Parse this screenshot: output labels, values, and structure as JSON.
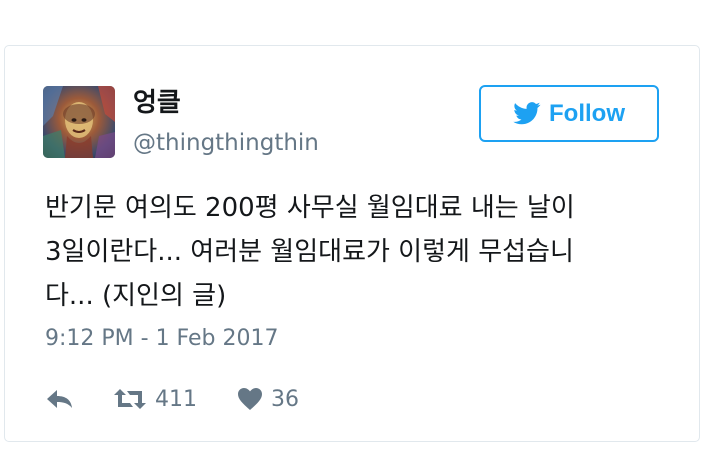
{
  "user": {
    "display_name": "엉클",
    "handle": "@thingthingthin"
  },
  "follow_button": {
    "label": "Follow"
  },
  "tweet": {
    "text": "반기문 여의도 200평 사무실 월임대료 내는 날이\n3일이란다... 여러분 월임대료가 이렇게 무섭습니\n다... (지인의 글)",
    "timestamp": "9:12 PM - 1 Feb 2017"
  },
  "stats": {
    "retweets": "411",
    "likes": "36"
  },
  "colors": {
    "accent": "#1da1f2",
    "text": "#14171a",
    "muted": "#657786",
    "border": "#e1e8ed"
  },
  "icons": {
    "follow": "twitter-bird-icon",
    "reply": "reply-icon",
    "retweet": "retweet-icon",
    "like": "heart-icon"
  }
}
